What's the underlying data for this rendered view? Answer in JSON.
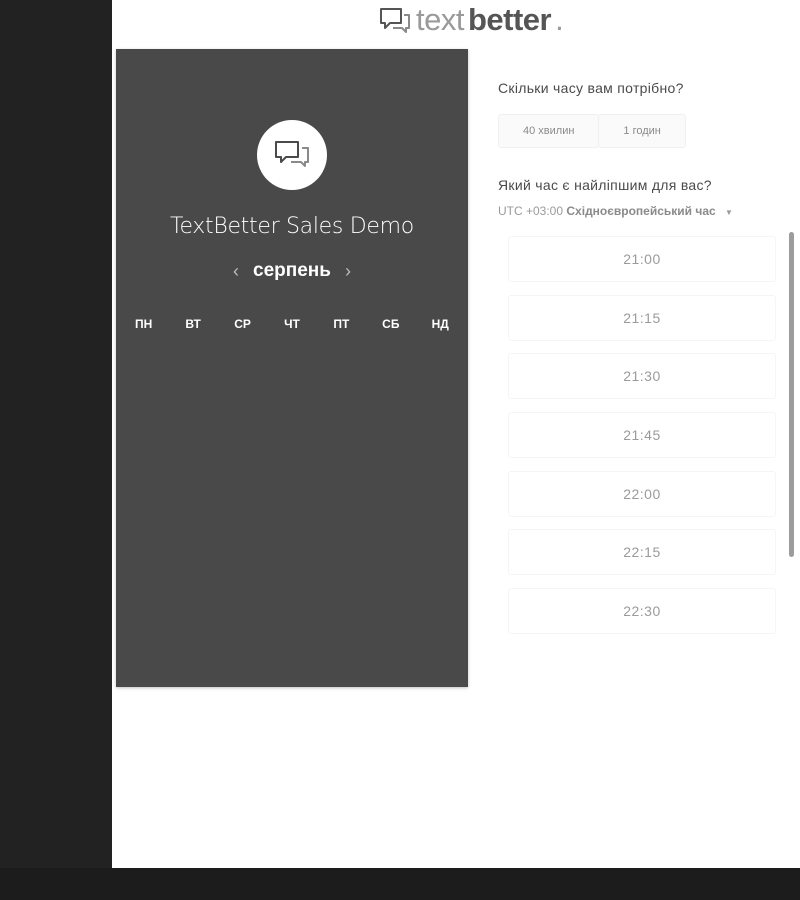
{
  "logo": {
    "light": "text",
    "bold": "better",
    "dot": ".",
    "icon": "chat-bubbles-icon"
  },
  "event": {
    "title": "TextBetter Sales Demo",
    "month": "серпень",
    "prev_icon": "‹",
    "next_icon": "›",
    "weekdays": [
      "ПН",
      "ВТ",
      "СР",
      "ЧТ",
      "ПТ",
      "СБ",
      "НД"
    ]
  },
  "duration": {
    "question": "Скільки часу вам потрібно?",
    "options": [
      "40 хвилин",
      "1 годин"
    ]
  },
  "time": {
    "question": "Який час є найліпшим для вас?",
    "tz_offset": "UTC +03:00",
    "tz_name": "Східноєвропейський час",
    "slots": [
      "21:00",
      "21:15",
      "21:30",
      "21:45",
      "22:00",
      "22:15",
      "22:30"
    ]
  },
  "colors": {
    "panel": "#494949",
    "background": "#222222"
  }
}
